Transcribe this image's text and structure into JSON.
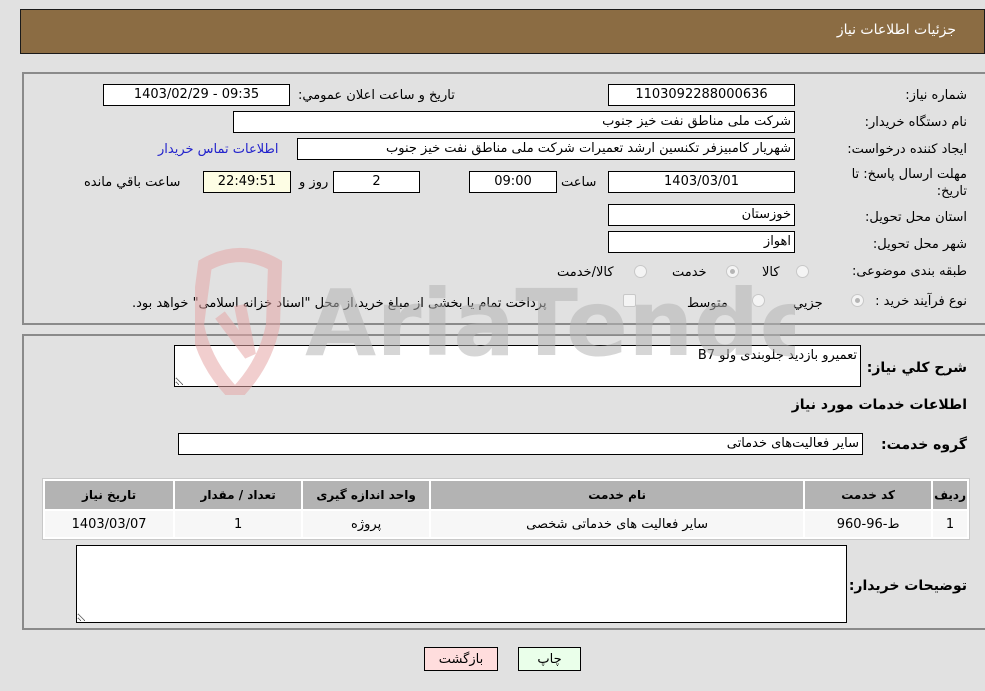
{
  "header": {
    "title": "جزئیات اطلاعات نیاز"
  },
  "form": {
    "need_number_label": "شماره نیاز:",
    "need_number": "1103092288000636",
    "announce_label": "تاریخ و ساعت اعلان عمومي:",
    "announce_value": "1403/02/29 - 09:35",
    "buyer_org_label": "نام دستگاه خریدار:",
    "buyer_org": "شرکت ملی مناطق نفت خیز جنوب",
    "creator_label": "ایجاد کننده درخواست:",
    "creator": "شهریار کامبیزفر تکنسین ارشد تعمیرات شرکت ملی مناطق نفت خیز جنوب",
    "contact_link": "اطلاعات تماس خریدار",
    "deadline_label": "مهلت ارسال پاسخ: تا تاریخ:",
    "deadline_date": "1403/03/01",
    "time_label": "ساعت",
    "deadline_time": "09:00",
    "days_value": "2",
    "days_label": "روز و",
    "remaining_time": "22:49:51",
    "remaining_label": "ساعت باقي مانده",
    "province_label": "استان محل تحویل:",
    "province": "خوزستان",
    "city_label": "شهر محل تحویل:",
    "city": "اهواز",
    "category_label": "طبقه بندی موضوعی:",
    "category_options": [
      {
        "label": "کالا",
        "selected": false
      },
      {
        "label": "خدمت",
        "selected": true
      },
      {
        "label": "کالا/خدمت",
        "selected": false
      }
    ],
    "process_label": "نوع فرآیند خرید :",
    "process_options": [
      {
        "label": "جزیي",
        "selected": true
      },
      {
        "label": "متوسط",
        "selected": false
      }
    ],
    "treasury_checkbox_label": "پرداخت تمام یا بخشی از مبلغ خرید،از محل \"اسناد خزانه اسلامی\" خواهد بود.",
    "treasury_checked": false
  },
  "details": {
    "description_label": "شرح کلي نیاز:",
    "description": "تعمیرو بازدید جلوبندی ولو B7",
    "services_heading": "اطلاعات خدمات مورد نیاز",
    "service_group_label": "گروه خدمت:",
    "service_group": "سایر فعالیت‌های خدماتی",
    "table": {
      "headers": [
        "ردیف",
        "کد خدمت",
        "نام خدمت",
        "واحد اندازه گیری",
        "تعداد / مقدار",
        "تاریخ نیاز"
      ],
      "rows": [
        [
          "1",
          "ط-96-960",
          "سایر فعالیت های خدماتی شخصی",
          "پروژه",
          "1",
          "1403/03/07"
        ]
      ]
    },
    "buyer_notes_label": "توضیحات خریدار:",
    "buyer_notes": ""
  },
  "buttons": {
    "print": "چاپ",
    "back": "بازگشت"
  },
  "watermark": {
    "text": "AriaTender.net"
  },
  "colors": {
    "header_bg": "#8b6c43",
    "print_bg": "#eaffea",
    "back_bg": "#ffdddd",
    "link": "#2222cc"
  }
}
